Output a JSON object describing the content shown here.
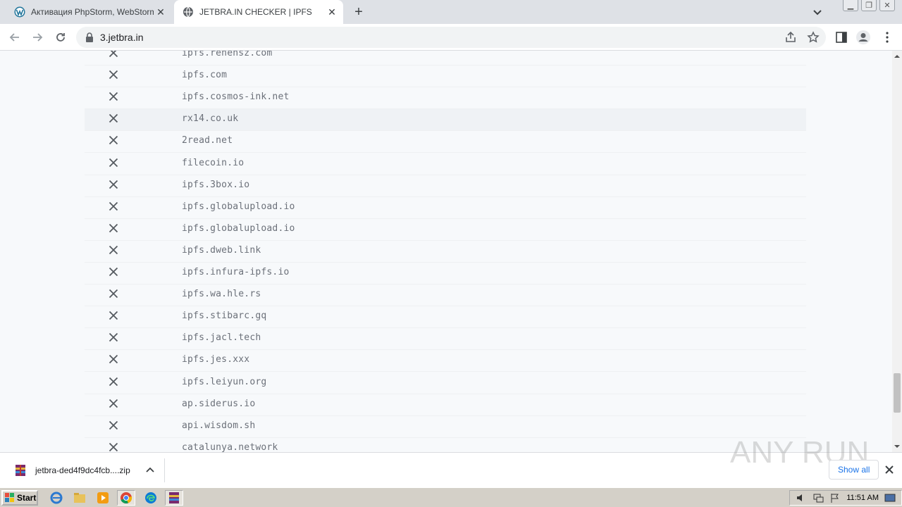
{
  "browser": {
    "tabs": [
      {
        "title": "Активация PhpStorm, WebStorm, I…",
        "active": false
      },
      {
        "title": "JETBRA.IN CHECKER | IPFS",
        "active": true
      }
    ],
    "url": "3.jetbra.in"
  },
  "page": {
    "rows": [
      {
        "domain": "ipfs.renehsz.com",
        "status": "unavailable"
      },
      {
        "domain": "ipfs.com",
        "status": "unavailable"
      },
      {
        "domain": "ipfs.cosmos-ink.net",
        "status": "unavailable"
      },
      {
        "domain": "rx14.co.uk",
        "status": "unavailable"
      },
      {
        "domain": "2read.net",
        "status": "unavailable"
      },
      {
        "domain": "filecoin.io",
        "status": "unavailable"
      },
      {
        "domain": "ipfs.3box.io",
        "status": "unavailable"
      },
      {
        "domain": "ipfs.globalupload.io",
        "status": "unavailable"
      },
      {
        "domain": "ipfs.globalupload.io",
        "status": "unavailable"
      },
      {
        "domain": "ipfs.dweb.link",
        "status": "unavailable"
      },
      {
        "domain": "ipfs.infura-ipfs.io",
        "status": "unavailable"
      },
      {
        "domain": "ipfs.wa.hle.rs",
        "status": "unavailable"
      },
      {
        "domain": "ipfs.stibarc.gq",
        "status": "unavailable"
      },
      {
        "domain": "ipfs.jacl.tech",
        "status": "unavailable"
      },
      {
        "domain": "ipfs.jes.xxx",
        "status": "unavailable"
      },
      {
        "domain": "ipfs.leiyun.org",
        "status": "unavailable"
      },
      {
        "domain": "ap.siderus.io",
        "status": "unavailable"
      },
      {
        "domain": "api.wisdom.sh",
        "status": "unavailable"
      },
      {
        "domain": "catalunya.network",
        "status": "unavailable"
      }
    ]
  },
  "downloads": {
    "file": "jetbra-ded4f9dc4fcb....zip",
    "show_all": "Show all"
  },
  "watermark": "ANY RUN",
  "taskbar": {
    "start": "Start",
    "clock": "11:51 AM"
  },
  "colors": {
    "x_mark": "#555a60",
    "domain_text": "#6b7079",
    "page_bg": "#f7f9fb"
  }
}
